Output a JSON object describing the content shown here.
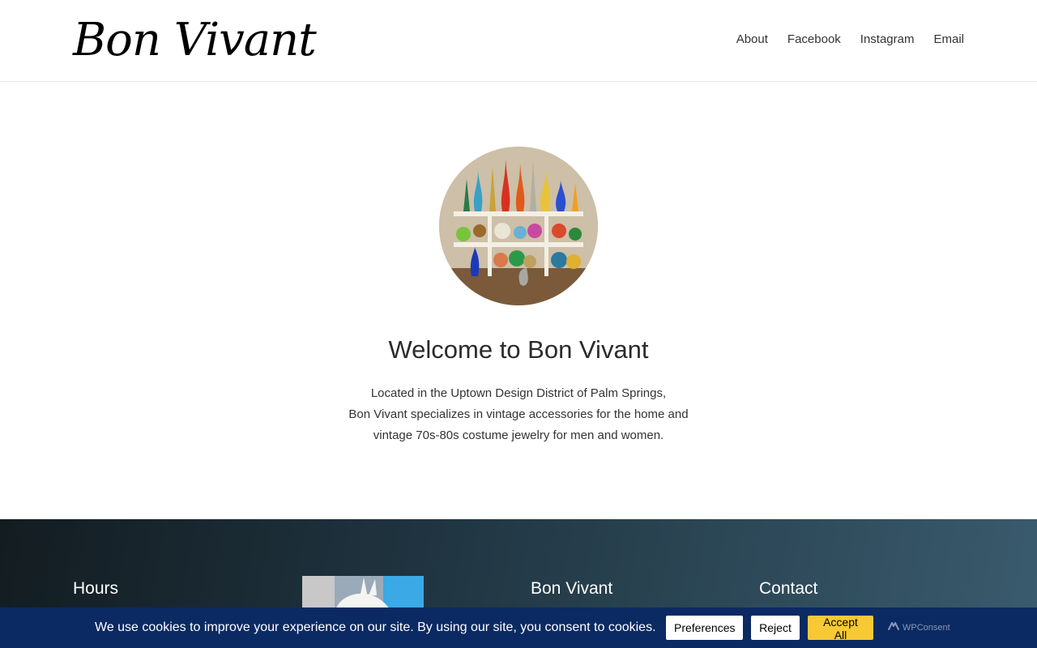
{
  "header": {
    "logo_text": "Bon Vivant",
    "nav": [
      "About",
      "Facebook",
      "Instagram",
      "Email"
    ]
  },
  "hero": {
    "image_alt": "shelves of colorful vintage glass decanters",
    "title": "Welcome to Bon Vivant",
    "description_lines": [
      "Located in the Uptown Design District of Palm Springs,",
      "Bon Vivant specializes in vintage accessories for the home and",
      "vintage 70s-80s costume jewelry for men and women."
    ]
  },
  "footer": {
    "hours_title": "Hours",
    "brand_title": "Bon Vivant",
    "contact_title": "Contact"
  },
  "cookie_bar": {
    "text": "We use cookies to improve your experience on our site. By using our site, you consent to cookies.",
    "preferences_label": "Preferences",
    "reject_label": "Reject",
    "accept_label": "Accept All",
    "brand": "WPConsent"
  },
  "colors": {
    "cookie_bar_bg": "#0b2a63",
    "accept_button": "#f7c934",
    "footer_gradient_start": "#131c21",
    "footer_gradient_end": "#3a5b6e"
  }
}
